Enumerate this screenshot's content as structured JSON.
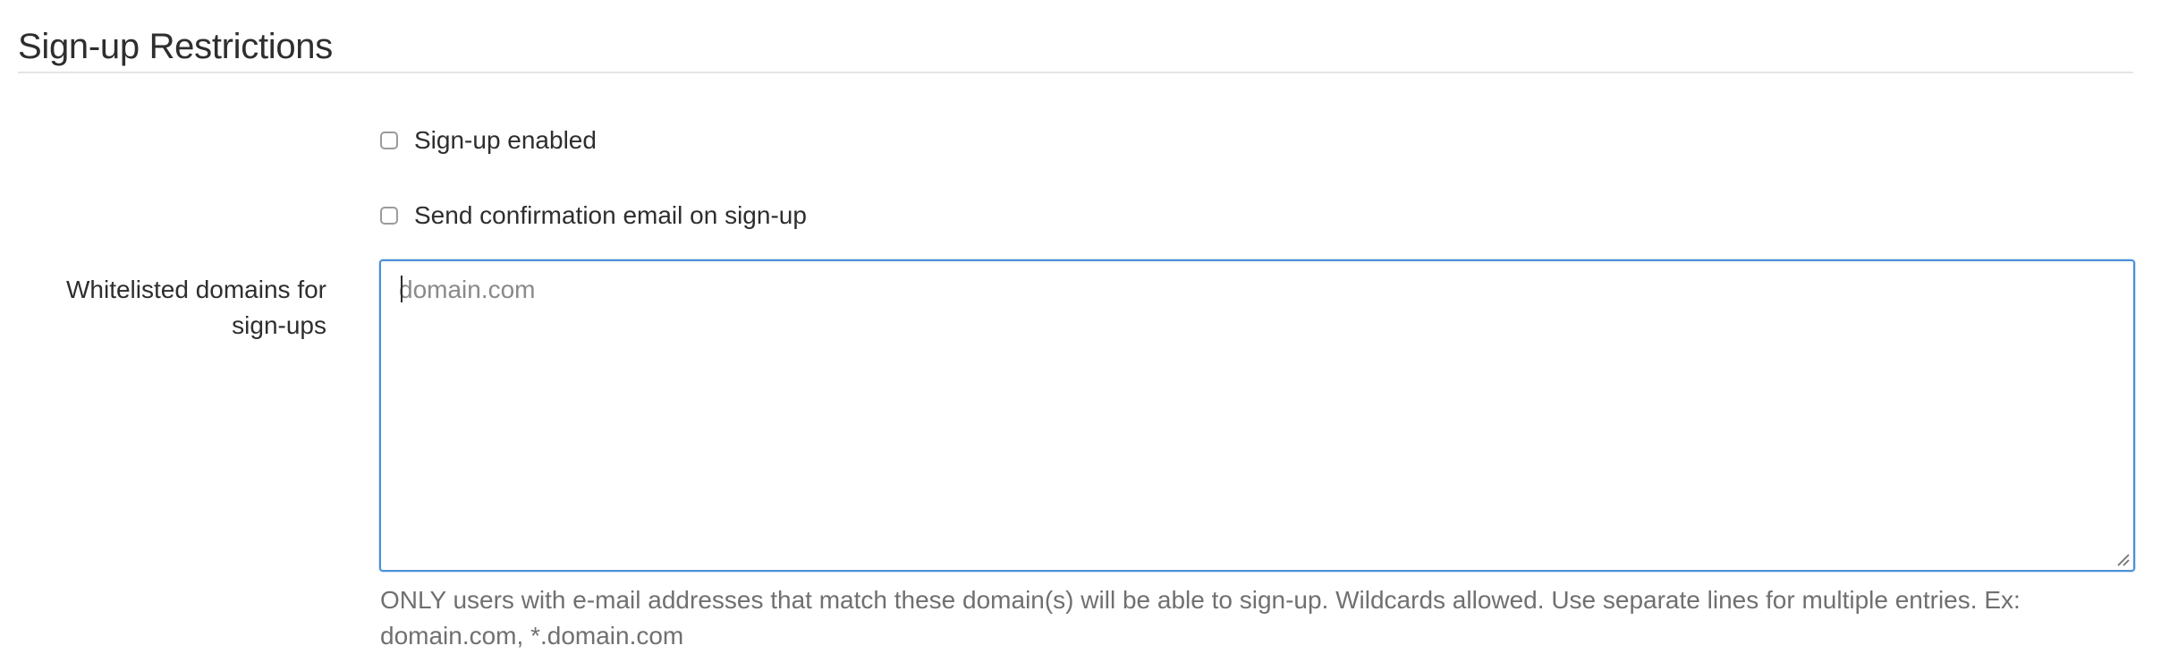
{
  "section": {
    "title": "Sign-up Restrictions"
  },
  "options": [
    {
      "label": "Sign-up enabled",
      "checked": false
    },
    {
      "label": "Send confirmation email on sign-up",
      "checked": false
    }
  ],
  "whitelist": {
    "label": "Whitelisted domains for sign-ups",
    "value": "",
    "placeholder": "domain.com",
    "help": "ONLY users with e-mail addresses that match these domain(s) will be able to sign-up. Wildcards allowed. Use separate lines for multiple entries. Ex: domain.com, *.domain.com"
  },
  "colors": {
    "focus_border": "#4a90d9",
    "text": "#2e2e2e",
    "muted_text": "#707070",
    "placeholder": "#8a8a8a"
  }
}
